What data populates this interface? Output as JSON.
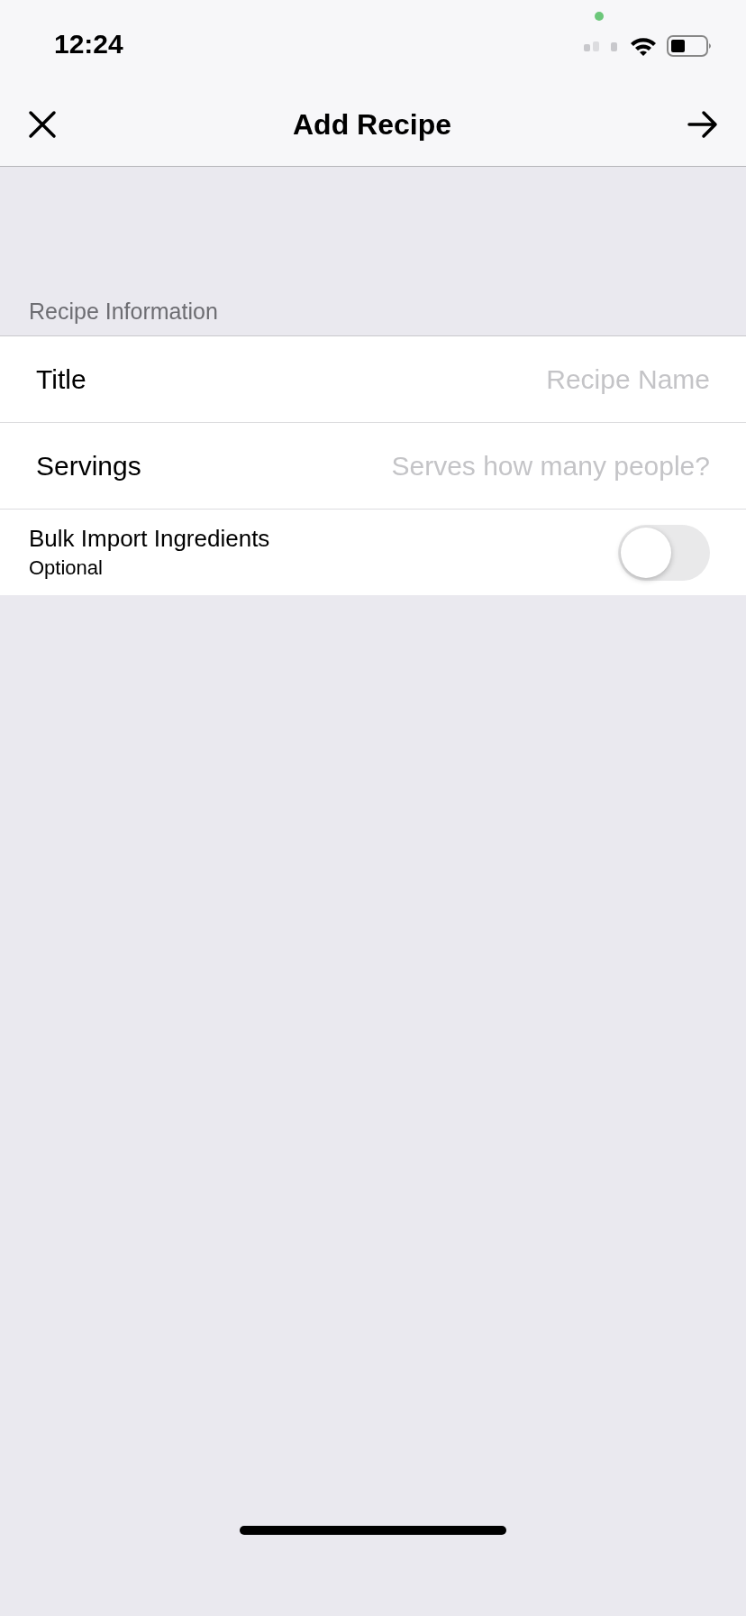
{
  "status_bar": {
    "time": "12:24"
  },
  "nav_bar": {
    "title": "Add Recipe"
  },
  "section": {
    "header": "Recipe Information",
    "rows": [
      {
        "kind": "text",
        "label": "Title",
        "placeholder": "Recipe Name"
      },
      {
        "kind": "text",
        "label": "Servings",
        "placeholder": "Serves how many people?"
      },
      {
        "kind": "toggle",
        "label": "Bulk Import Ingredients",
        "subtitle": "Optional",
        "on": false
      }
    ]
  }
}
